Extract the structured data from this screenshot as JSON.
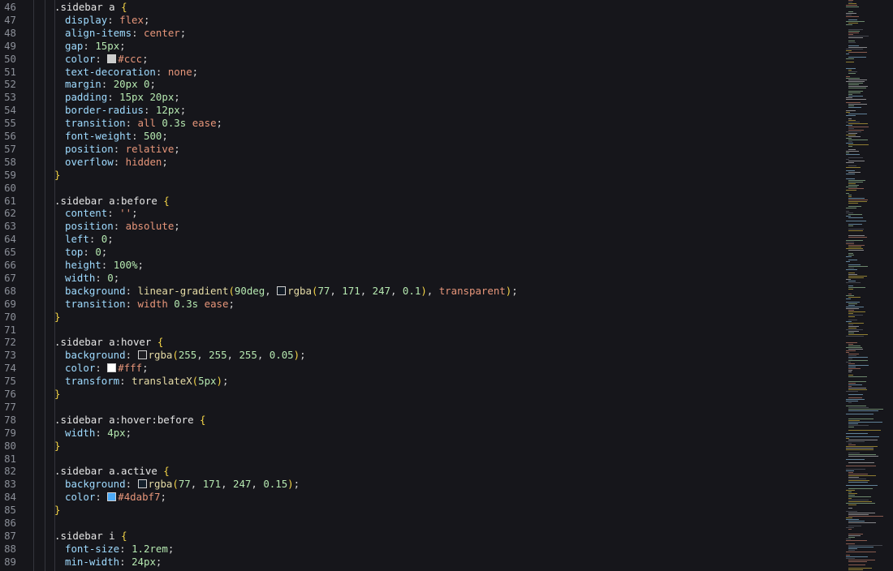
{
  "lines": [
    {
      "n": "46",
      "indent": 0,
      "parts": [
        {
          "c": "sel",
          "t": ".sidebar a "
        },
        {
          "c": "brace",
          "t": "{"
        }
      ]
    },
    {
      "n": "47",
      "indent": 1,
      "parts": [
        {
          "c": "prop",
          "t": "display"
        },
        {
          "c": "punct",
          "t": ": "
        },
        {
          "c": "kw",
          "t": "flex"
        },
        {
          "c": "punct",
          "t": ";"
        }
      ]
    },
    {
      "n": "48",
      "indent": 1,
      "parts": [
        {
          "c": "prop",
          "t": "align-items"
        },
        {
          "c": "punct",
          "t": ": "
        },
        {
          "c": "kw",
          "t": "center"
        },
        {
          "c": "punct",
          "t": ";"
        }
      ]
    },
    {
      "n": "49",
      "indent": 1,
      "parts": [
        {
          "c": "prop",
          "t": "gap"
        },
        {
          "c": "punct",
          "t": ": "
        },
        {
          "c": "num",
          "t": "15px"
        },
        {
          "c": "punct",
          "t": ";"
        }
      ]
    },
    {
      "n": "50",
      "indent": 1,
      "parts": [
        {
          "c": "prop",
          "t": "color"
        },
        {
          "c": "punct",
          "t": ": "
        },
        {
          "c": "swatch",
          "t": "#cccccc"
        },
        {
          "c": "kw",
          "t": "#ccc"
        },
        {
          "c": "punct",
          "t": ";"
        }
      ]
    },
    {
      "n": "51",
      "indent": 1,
      "parts": [
        {
          "c": "prop",
          "t": "text-decoration"
        },
        {
          "c": "punct",
          "t": ": "
        },
        {
          "c": "kw",
          "t": "none"
        },
        {
          "c": "punct",
          "t": ";"
        }
      ]
    },
    {
      "n": "52",
      "indent": 1,
      "parts": [
        {
          "c": "prop",
          "t": "margin"
        },
        {
          "c": "punct",
          "t": ": "
        },
        {
          "c": "num",
          "t": "20px 0"
        },
        {
          "c": "punct",
          "t": ";"
        }
      ]
    },
    {
      "n": "53",
      "indent": 1,
      "parts": [
        {
          "c": "prop",
          "t": "padding"
        },
        {
          "c": "punct",
          "t": ": "
        },
        {
          "c": "num",
          "t": "15px 20px"
        },
        {
          "c": "punct",
          "t": ";"
        }
      ]
    },
    {
      "n": "54",
      "indent": 1,
      "parts": [
        {
          "c": "prop",
          "t": "border-radius"
        },
        {
          "c": "punct",
          "t": ": "
        },
        {
          "c": "num",
          "t": "12px"
        },
        {
          "c": "punct",
          "t": ";"
        }
      ]
    },
    {
      "n": "55",
      "indent": 1,
      "parts": [
        {
          "c": "prop",
          "t": "transition"
        },
        {
          "c": "punct",
          "t": ": "
        },
        {
          "c": "kw",
          "t": "all "
        },
        {
          "c": "num",
          "t": "0.3s "
        },
        {
          "c": "kw",
          "t": "ease"
        },
        {
          "c": "punct",
          "t": ";"
        }
      ]
    },
    {
      "n": "56",
      "indent": 1,
      "parts": [
        {
          "c": "prop",
          "t": "font-weight"
        },
        {
          "c": "punct",
          "t": ": "
        },
        {
          "c": "num",
          "t": "500"
        },
        {
          "c": "punct",
          "t": ";"
        }
      ]
    },
    {
      "n": "57",
      "indent": 1,
      "parts": [
        {
          "c": "prop",
          "t": "position"
        },
        {
          "c": "punct",
          "t": ": "
        },
        {
          "c": "kw",
          "t": "relative"
        },
        {
          "c": "punct",
          "t": ";"
        }
      ]
    },
    {
      "n": "58",
      "indent": 1,
      "parts": [
        {
          "c": "prop",
          "t": "overflow"
        },
        {
          "c": "punct",
          "t": ": "
        },
        {
          "c": "kw",
          "t": "hidden"
        },
        {
          "c": "punct",
          "t": ";"
        }
      ]
    },
    {
      "n": "59",
      "indent": 0,
      "parts": [
        {
          "c": "brace",
          "t": "}"
        }
      ]
    },
    {
      "n": "60",
      "indent": 0,
      "parts": []
    },
    {
      "n": "61",
      "indent": 0,
      "parts": [
        {
          "c": "sel",
          "t": ".sidebar a:before "
        },
        {
          "c": "brace",
          "t": "{"
        }
      ]
    },
    {
      "n": "62",
      "indent": 1,
      "parts": [
        {
          "c": "prop",
          "t": "content"
        },
        {
          "c": "punct",
          "t": ": "
        },
        {
          "c": "str",
          "t": "''"
        },
        {
          "c": "punct",
          "t": ";"
        }
      ]
    },
    {
      "n": "63",
      "indent": 1,
      "parts": [
        {
          "c": "prop",
          "t": "position"
        },
        {
          "c": "punct",
          "t": ": "
        },
        {
          "c": "kw",
          "t": "absolute"
        },
        {
          "c": "punct",
          "t": ";"
        }
      ]
    },
    {
      "n": "64",
      "indent": 1,
      "parts": [
        {
          "c": "prop",
          "t": "left"
        },
        {
          "c": "punct",
          "t": ": "
        },
        {
          "c": "num",
          "t": "0"
        },
        {
          "c": "punct",
          "t": ";"
        }
      ]
    },
    {
      "n": "65",
      "indent": 1,
      "parts": [
        {
          "c": "prop",
          "t": "top"
        },
        {
          "c": "punct",
          "t": ": "
        },
        {
          "c": "num",
          "t": "0"
        },
        {
          "c": "punct",
          "t": ";"
        }
      ]
    },
    {
      "n": "66",
      "indent": 1,
      "parts": [
        {
          "c": "prop",
          "t": "height"
        },
        {
          "c": "punct",
          "t": ": "
        },
        {
          "c": "num",
          "t": "100%"
        },
        {
          "c": "punct",
          "t": ";"
        }
      ]
    },
    {
      "n": "67",
      "indent": 1,
      "parts": [
        {
          "c": "prop",
          "t": "width"
        },
        {
          "c": "punct",
          "t": ": "
        },
        {
          "c": "num",
          "t": "0"
        },
        {
          "c": "punct",
          "t": ";"
        }
      ]
    },
    {
      "n": "68",
      "indent": 1,
      "parts": [
        {
          "c": "prop",
          "t": "background"
        },
        {
          "c": "punct",
          "t": ": "
        },
        {
          "c": "fn",
          "t": "linear-gradient"
        },
        {
          "c": "paren",
          "t": "("
        },
        {
          "c": "num",
          "t": "90deg"
        },
        {
          "c": "punct",
          "t": ", "
        },
        {
          "c": "swatch",
          "t": "#121a24"
        },
        {
          "c": "fn",
          "t": "rgba"
        },
        {
          "c": "paren",
          "t": "("
        },
        {
          "c": "num",
          "t": "77"
        },
        {
          "c": "punct",
          "t": ", "
        },
        {
          "c": "num",
          "t": "171"
        },
        {
          "c": "punct",
          "t": ", "
        },
        {
          "c": "num",
          "t": "247"
        },
        {
          "c": "punct",
          "t": ", "
        },
        {
          "c": "num",
          "t": "0.1"
        },
        {
          "c": "paren",
          "t": ")"
        },
        {
          "c": "punct",
          "t": ", "
        },
        {
          "c": "kw",
          "t": "transparent"
        },
        {
          "c": "paren",
          "t": ")"
        },
        {
          "c": "punct",
          "t": ";"
        }
      ]
    },
    {
      "n": "69",
      "indent": 1,
      "parts": [
        {
          "c": "prop",
          "t": "transition"
        },
        {
          "c": "punct",
          "t": ": "
        },
        {
          "c": "kw",
          "t": "width "
        },
        {
          "c": "num",
          "t": "0.3s "
        },
        {
          "c": "kw",
          "t": "ease"
        },
        {
          "c": "punct",
          "t": ";"
        }
      ]
    },
    {
      "n": "70",
      "indent": 0,
      "parts": [
        {
          "c": "brace",
          "t": "}"
        }
      ]
    },
    {
      "n": "71",
      "indent": 0,
      "parts": []
    },
    {
      "n": "72",
      "indent": 0,
      "parts": [
        {
          "c": "sel",
          "t": ".sidebar a:hover "
        },
        {
          "c": "brace",
          "t": "{"
        }
      ]
    },
    {
      "n": "73",
      "indent": 1,
      "parts": [
        {
          "c": "prop",
          "t": "background"
        },
        {
          "c": "punct",
          "t": ": "
        },
        {
          "c": "swatch",
          "t": "#1e1e22"
        },
        {
          "c": "fn",
          "t": "rgba"
        },
        {
          "c": "paren",
          "t": "("
        },
        {
          "c": "num",
          "t": "255"
        },
        {
          "c": "punct",
          "t": ", "
        },
        {
          "c": "num",
          "t": "255"
        },
        {
          "c": "punct",
          "t": ", "
        },
        {
          "c": "num",
          "t": "255"
        },
        {
          "c": "punct",
          "t": ", "
        },
        {
          "c": "num",
          "t": "0.05"
        },
        {
          "c": "paren",
          "t": ")"
        },
        {
          "c": "punct",
          "t": ";"
        }
      ]
    },
    {
      "n": "74",
      "indent": 1,
      "parts": [
        {
          "c": "prop",
          "t": "color"
        },
        {
          "c": "punct",
          "t": ": "
        },
        {
          "c": "swatch",
          "t": "#ffffff"
        },
        {
          "c": "kw",
          "t": "#fff"
        },
        {
          "c": "punct",
          "t": ";"
        }
      ]
    },
    {
      "n": "75",
      "indent": 1,
      "parts": [
        {
          "c": "prop",
          "t": "transform"
        },
        {
          "c": "punct",
          "t": ": "
        },
        {
          "c": "fn",
          "t": "translateX"
        },
        {
          "c": "paren",
          "t": "("
        },
        {
          "c": "num",
          "t": "5px"
        },
        {
          "c": "paren",
          "t": ")"
        },
        {
          "c": "punct",
          "t": ";"
        }
      ]
    },
    {
      "n": "76",
      "indent": 0,
      "parts": [
        {
          "c": "brace",
          "t": "}"
        }
      ]
    },
    {
      "n": "77",
      "indent": 0,
      "parts": []
    },
    {
      "n": "78",
      "indent": 0,
      "parts": [
        {
          "c": "sel",
          "t": ".sidebar a:hover:before "
        },
        {
          "c": "brace",
          "t": "{"
        }
      ]
    },
    {
      "n": "79",
      "indent": 1,
      "parts": [
        {
          "c": "prop",
          "t": "width"
        },
        {
          "c": "punct",
          "t": ": "
        },
        {
          "c": "num",
          "t": "4px"
        },
        {
          "c": "punct",
          "t": ";"
        }
      ]
    },
    {
      "n": "80",
      "indent": 0,
      "parts": [
        {
          "c": "brace",
          "t": "}"
        }
      ]
    },
    {
      "n": "81",
      "indent": 0,
      "parts": []
    },
    {
      "n": "82",
      "indent": 0,
      "parts": [
        {
          "c": "sel",
          "t": ".sidebar a.active "
        },
        {
          "c": "brace",
          "t": "{"
        }
      ]
    },
    {
      "n": "83",
      "indent": 1,
      "parts": [
        {
          "c": "prop",
          "t": "background"
        },
        {
          "c": "punct",
          "t": ": "
        },
        {
          "c": "swatch",
          "t": "#14202c"
        },
        {
          "c": "fn",
          "t": "rgba"
        },
        {
          "c": "paren",
          "t": "("
        },
        {
          "c": "num",
          "t": "77"
        },
        {
          "c": "punct",
          "t": ", "
        },
        {
          "c": "num",
          "t": "171"
        },
        {
          "c": "punct",
          "t": ", "
        },
        {
          "c": "num",
          "t": "247"
        },
        {
          "c": "punct",
          "t": ", "
        },
        {
          "c": "num",
          "t": "0.15"
        },
        {
          "c": "paren",
          "t": ")"
        },
        {
          "c": "punct",
          "t": ";"
        }
      ]
    },
    {
      "n": "84",
      "indent": 1,
      "parts": [
        {
          "c": "prop",
          "t": "color"
        },
        {
          "c": "punct",
          "t": ": "
        },
        {
          "c": "swatch",
          "t": "#4dabf7"
        },
        {
          "c": "kw",
          "t": "#4dabf7"
        },
        {
          "c": "punct",
          "t": ";"
        }
      ]
    },
    {
      "n": "85",
      "indent": 0,
      "parts": [
        {
          "c": "brace",
          "t": "}"
        }
      ]
    },
    {
      "n": "86",
      "indent": 0,
      "parts": []
    },
    {
      "n": "87",
      "indent": 0,
      "parts": [
        {
          "c": "sel",
          "t": ".sidebar i "
        },
        {
          "c": "brace",
          "t": "{"
        }
      ]
    },
    {
      "n": "88",
      "indent": 1,
      "parts": [
        {
          "c": "prop",
          "t": "font-size"
        },
        {
          "c": "punct",
          "t": ": "
        },
        {
          "c": "num",
          "t": "1.2rem"
        },
        {
          "c": "punct",
          "t": ";"
        }
      ]
    },
    {
      "n": "89",
      "indent": 1,
      "parts": [
        {
          "c": "prop",
          "t": "min-width"
        },
        {
          "c": "punct",
          "t": ": "
        },
        {
          "c": "num",
          "t": "24px"
        },
        {
          "c": "punct",
          "t": ";"
        }
      ]
    }
  ],
  "colors": {
    "background": "#16161b",
    "line_number": "#8b8f98",
    "selector": "#e6e6e6",
    "brace": "#f5d547",
    "property": "#9fdbff",
    "number": "#b5e8b0",
    "keyword": "#e7967a",
    "function": "#e6dca6"
  }
}
